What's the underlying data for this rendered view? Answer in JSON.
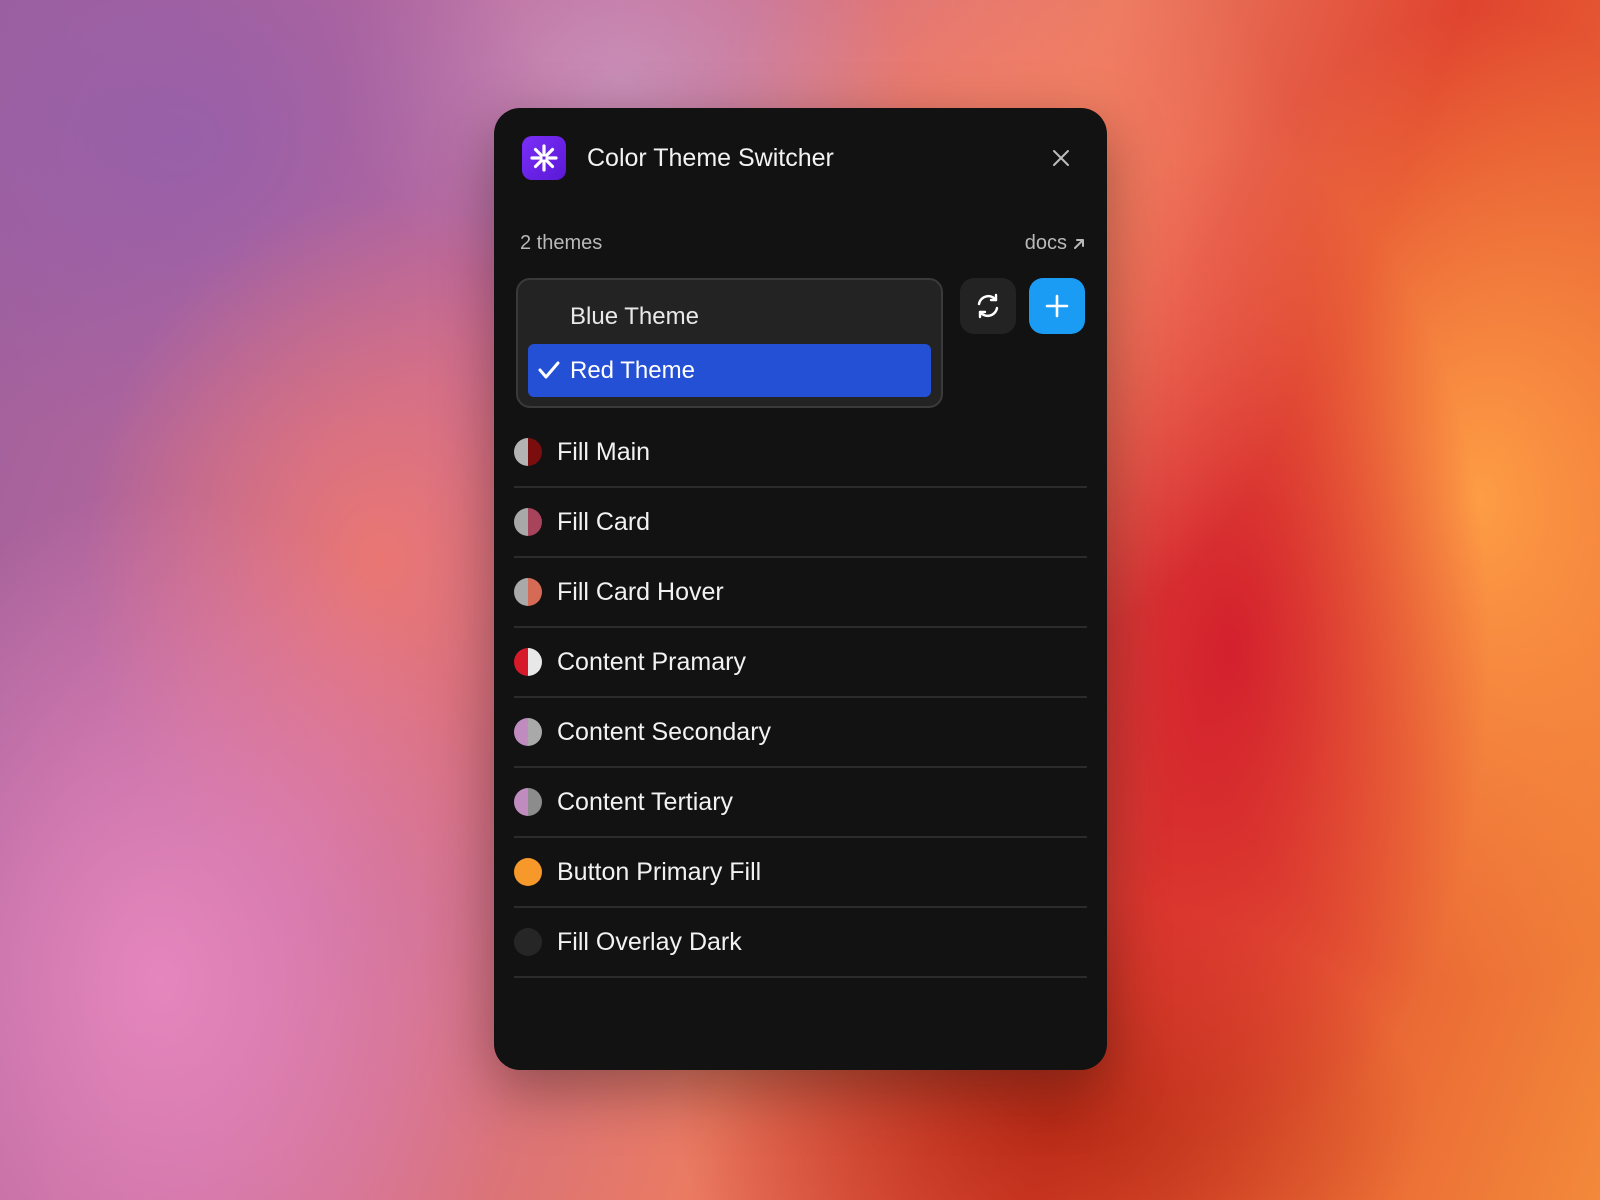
{
  "header": {
    "title": "Color Theme Switcher",
    "logo_icon": "sparkle-burst-icon",
    "close_icon": "close-icon"
  },
  "meta": {
    "count_label": "2 themes",
    "docs_label": "docs",
    "docs_icon": "arrow-up-right-icon"
  },
  "themes": {
    "options": [
      {
        "label": "Blue Theme",
        "selected": false
      },
      {
        "label": "Red Theme",
        "selected": true
      }
    ],
    "selected_color": "#2450d6"
  },
  "actions": {
    "sync_icon": "refresh-icon",
    "add_icon": "plus-icon",
    "add_color": "#1a9cf5"
  },
  "tokens": [
    {
      "label": "Fill Main",
      "left_color": "#b3b3b3",
      "right_color": "#7a0e0e"
    },
    {
      "label": "Fill Card",
      "left_color": "#a8a8a8",
      "right_color": "#a8435c"
    },
    {
      "label": "Fill Card Hover",
      "left_color": "#a9a9a9",
      "right_color": "#d66b55"
    },
    {
      "label": "Content Pramary",
      "left_color": "#d61a2a",
      "right_color": "#e8e8e8"
    },
    {
      "label": "Content Secondary",
      "left_color": "#c08cbf",
      "right_color": "#a9a9a9"
    },
    {
      "label": "Content Tertiary",
      "left_color": "#c08cbf",
      "right_color": "#8c8c8c"
    },
    {
      "label": "Button Primary Fill",
      "left_color": "#f7982a",
      "right_color": "#f7982a"
    },
    {
      "label": "Fill Overlay Dark",
      "left_color": "#262626",
      "right_color": "#262626"
    }
  ]
}
